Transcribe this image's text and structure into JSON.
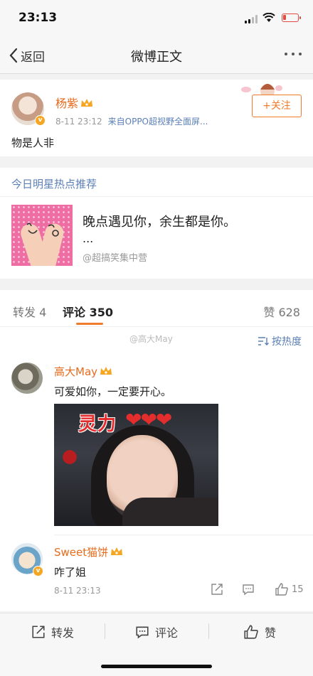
{
  "status_bar": {
    "time": "23:13"
  },
  "nav": {
    "back_label": "返回",
    "title": "微博正文"
  },
  "post": {
    "author": "杨紫",
    "time": "8-11 23:12",
    "source": "来自OPPO超视野全面屏...",
    "follow_label": "+关注",
    "text": "物是人非"
  },
  "hot": {
    "label": "今日明星热点推荐",
    "headline": "晚点遇见你，余生都是你。",
    "ellipsis": "...",
    "source": "@超搞笑集中营"
  },
  "tabs": {
    "repost": "转发 4",
    "comment": "评论 350",
    "like": "赞 628"
  },
  "watermark": "@高大May",
  "sort_label": "按热度",
  "comments": [
    {
      "author": "高大May",
      "text": "可爱如你，一定要开心。",
      "image_caption": "灵力",
      "image_hearts": "❤❤❤"
    },
    {
      "author": "Sweet猫饼",
      "text": "咋了姐",
      "time": "8-11 23:13",
      "like_count": "15"
    }
  ],
  "bottom_bar": {
    "repost": "转发",
    "comment": "评论",
    "like": "赞"
  },
  "colors": {
    "accent": "#f07b2a",
    "name": "#e86b1d",
    "link": "#5b7fb5"
  }
}
